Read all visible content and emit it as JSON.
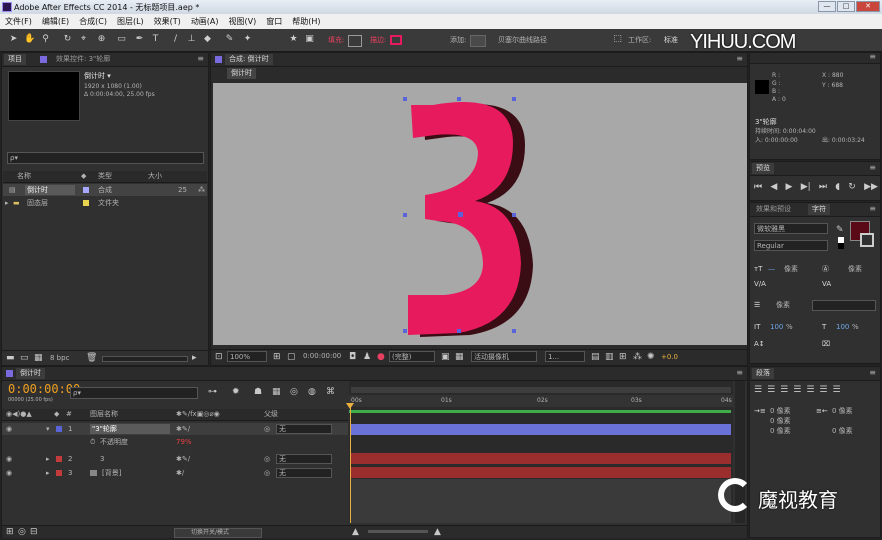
{
  "window": {
    "title": "Adobe After Effects CC 2014 - 无标题项目.aep *",
    "controls": [
      "—",
      "□",
      "✕"
    ]
  },
  "menu": [
    "文件(F)",
    "编辑(E)",
    "合成(C)",
    "图层(L)",
    "效果(T)",
    "动画(A)",
    "视图(V)",
    "窗口",
    "帮助(H)"
  ],
  "toolbar": {
    "fill_label": "填充:",
    "stroke_label": "描边:",
    "add_label": "添加:",
    "bezier_label": "贝塞尔曲线路径",
    "workspace_label": "工作区:",
    "workspace_value": "标准",
    "fill_color": "#e81a5e",
    "stroke_color": "#e81a5e"
  },
  "watermark": {
    "text": "YIHUU.COM",
    "brand": "魔视教育"
  },
  "project": {
    "tabs": [
      "项目",
      "效果控件: 3\"轮廓"
    ],
    "comp_name": "倒计时 ▾",
    "comp_info1": "1920 x 1080 (1.00)",
    "comp_info2": "Δ 0:00:04:00, 25.00 fps",
    "search_placeholder": "ρ▾",
    "columns": [
      "名称",
      "类型",
      "大小"
    ],
    "items": [
      {
        "name": "倒计时",
        "type": "合成",
        "size": "25",
        "color": "#a8a8ff",
        "selected": true
      },
      {
        "name": "固态层",
        "type": "文件夹",
        "size": "",
        "color": "#e8d44d",
        "selected": false
      }
    ],
    "footer_bpc": "8 bpc"
  },
  "comp": {
    "tab_title": "合成: 倒计时",
    "subtab": "倒计时",
    "glyph": "3",
    "glyph_color": "#e81a5e",
    "shadow_color": "#3a0d14",
    "zoom": "100%",
    "timecode": "0:00:00:00",
    "resolution": "(完整)",
    "camera": "活动摄像机",
    "views": "1...",
    "exposure": "+0.0"
  },
  "info": {
    "r": "R :",
    "g": "G :",
    "b": "B :",
    "a": "A : 0",
    "x": "X : 880",
    "y": "Y : 688",
    "layer": "3\"轮廓",
    "duration": "持续时间: 0:00:04:00",
    "inout": "入: 0:00:00:00",
    "out": "出: 0:00:03:24"
  },
  "preview": {
    "tab": "预览"
  },
  "character": {
    "tabs": [
      "效果和预设",
      "字符"
    ],
    "font": "微软雅黑",
    "style": "Regular",
    "size1": "像素",
    "size2": "像素",
    "tracking": "像素",
    "pct1": "%",
    "pct2": "%",
    "color": "#5a0a16"
  },
  "paragraph": {
    "tab": "段落",
    "v1": "0 像素",
    "v2": "0 像素",
    "v3": "0 像素",
    "v4": "0 像素",
    "v5": "0 像素"
  },
  "timeline": {
    "tab": "倒计时",
    "timecode": "0:00:00:00",
    "timecode_sub": "00000 (25.00 fps)",
    "search_placeholder": "ρ▾",
    "columns": {
      "name": "图层名称",
      "parent": "父级"
    },
    "layers": [
      {
        "num": "1",
        "name": "\"3\"轮廓",
        "parent": "无",
        "color": "#5a63d8",
        "selected": true
      },
      {
        "num": "",
        "name": "不透明度",
        "parent": "",
        "color": "",
        "selected": false,
        "prop": true,
        "value": "79%"
      },
      {
        "num": "2",
        "name": "3",
        "parent": "无",
        "color": "#c43b3b",
        "selected": false
      },
      {
        "num": "3",
        "name": "[背景]",
        "parent": "无",
        "color": "#c43b3b",
        "selected": false
      }
    ],
    "ruler": [
      "00s",
      "01s",
      "02s",
      "03s",
      "04s"
    ],
    "footer": "切换开关/模式"
  }
}
